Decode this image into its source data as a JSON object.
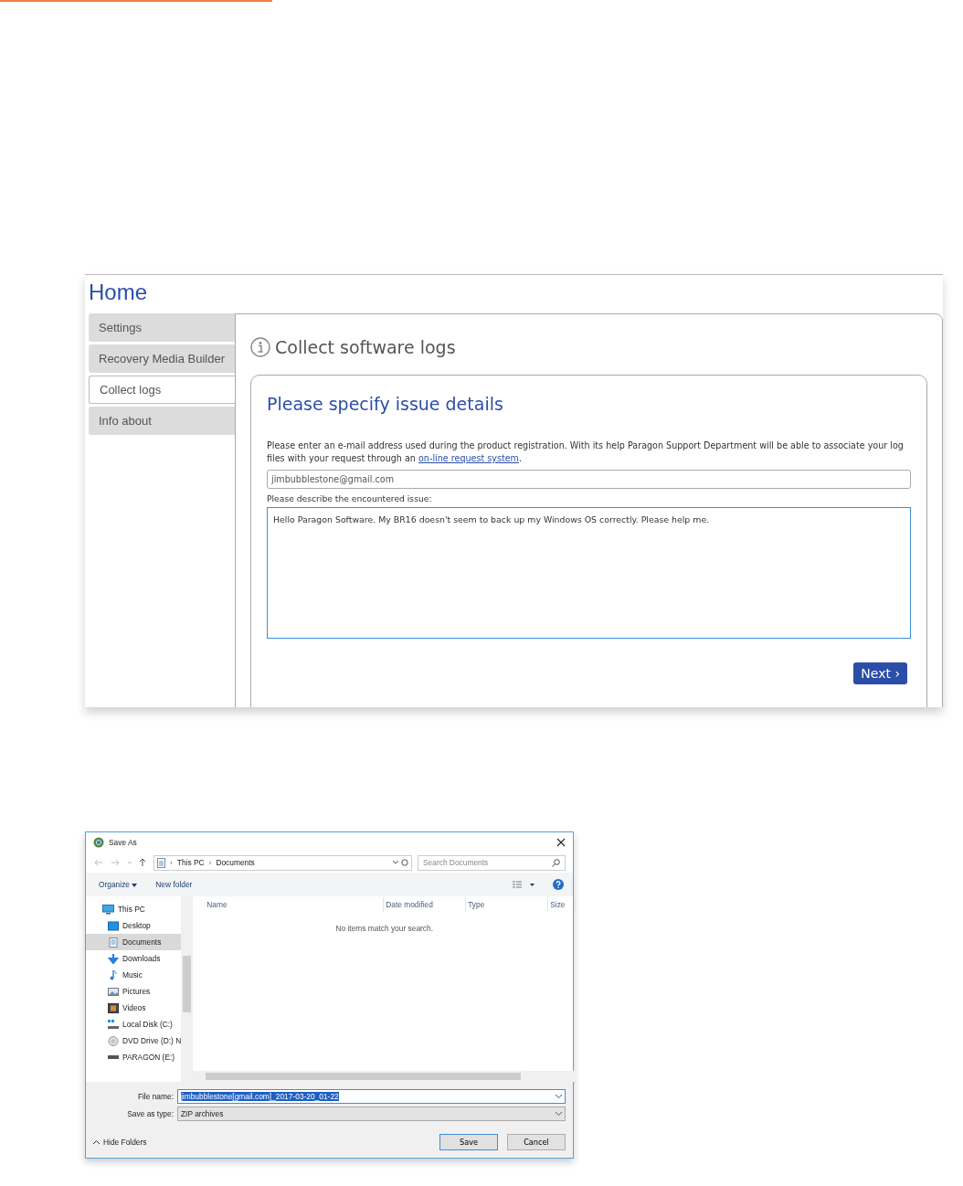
{
  "app": {
    "title": "Home",
    "sidebar": [
      {
        "label": "Settings",
        "selected": false
      },
      {
        "label": "Recovery Media Builder",
        "selected": false
      },
      {
        "label": "Collect logs",
        "selected": true
      },
      {
        "label": "Info about",
        "selected": false
      }
    ],
    "panel": {
      "title": "Collect software logs",
      "form": {
        "heading": "Please specify issue details",
        "intro": "Please enter an e-mail address used during the product registration. With its help Paragon Support Department will be able to associate your log files with your request through an",
        "link": "on-line request system",
        "intro_end": ".",
        "email": {
          "value": "jimbubblestone@gmail.com"
        },
        "issue_label": "Please describe the encountered issue:",
        "issue": {
          "value": "Hello Paragon Software. My BR16 doesn't seem to back up my Windows OS correctly. Please help me."
        },
        "next_button": {
          "label": "Next",
          "arrow": "›"
        }
      }
    }
  },
  "save_dialog": {
    "title": "Save As",
    "breadcrumb": [
      "This PC",
      "Documents"
    ],
    "search": {
      "placeholder": "Search Documents"
    },
    "toolbar": {
      "organize": "Organize",
      "new_folder": "New folder"
    },
    "nav": [
      {
        "label": "This PC",
        "selected": false,
        "children": [
          {
            "label": "Desktop",
            "selected": false
          },
          {
            "label": "Documents",
            "selected": true
          },
          {
            "label": "Downloads",
            "selected": false
          },
          {
            "label": "Music",
            "selected": false
          },
          {
            "label": "Pictures",
            "selected": false
          },
          {
            "label": "Videos",
            "selected": false
          },
          {
            "label": "Local Disk (C:)",
            "selected": false
          },
          {
            "label": "DVD Drive (D:) N",
            "selected": false
          },
          {
            "label": "PARAGON (E:)",
            "selected": false
          }
        ]
      }
    ],
    "columns": [
      "Name",
      "Date modified",
      "Type",
      "Size"
    ],
    "empty_message": "No items match your search.",
    "file_name": {
      "label": "File name:",
      "value": "jimbubblestone[gmail.com]_2017-03-20_01-22"
    },
    "save_as_type": {
      "label": "Save as type:",
      "value": "ZIP archives"
    },
    "hide_folders": "Hide Folders",
    "buttons": [
      "Save",
      "Cancel"
    ]
  }
}
